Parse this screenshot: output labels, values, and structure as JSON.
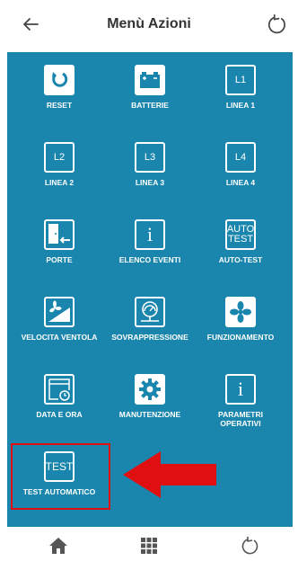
{
  "header": {
    "title": "Menù Azioni"
  },
  "tiles": [
    {
      "label": "RESET"
    },
    {
      "label": "BATTERIE"
    },
    {
      "label": "LINEA 1",
      "icon_text": "L1"
    },
    {
      "label": "LINEA 2",
      "icon_text": "L2"
    },
    {
      "label": "LINEA 3",
      "icon_text": "L3"
    },
    {
      "label": "LINEA 4",
      "icon_text": "L4"
    },
    {
      "label": "PORTE"
    },
    {
      "label": "ELENCO EVENTI",
      "icon_text": "i"
    },
    {
      "label": "AUTO-TEST",
      "icon_text_1": "AUTO",
      "icon_text_2": "TEST"
    },
    {
      "label": "VELOCITA VENTOLA"
    },
    {
      "label": "SOVRAPPRESSIONE"
    },
    {
      "label": "FUNZIONAMENTO"
    },
    {
      "label": "DATA E ORA"
    },
    {
      "label": "MANUTENZIONE"
    },
    {
      "label_1": "PARAMETRI",
      "label_2": "OPERATIVI",
      "icon_text": "i"
    },
    {
      "label": "TEST AUTOMATICO",
      "icon_text": "TEST"
    }
  ],
  "colors": {
    "panel": "#1a86ad",
    "highlight": "#e01010",
    "text": "#ffffff"
  },
  "icons": [
    "back-arrow-icon",
    "refresh-icon",
    "reset-icon",
    "battery-icon",
    "line-icon",
    "door-icon",
    "info-icon",
    "autotest-icon",
    "fan-speed-icon",
    "pressure-gauge-icon",
    "fan-icon",
    "calendar-clock-icon",
    "gear-icon",
    "info-icon",
    "test-icon",
    "home-icon",
    "grid-icon",
    "refresh-icon"
  ]
}
